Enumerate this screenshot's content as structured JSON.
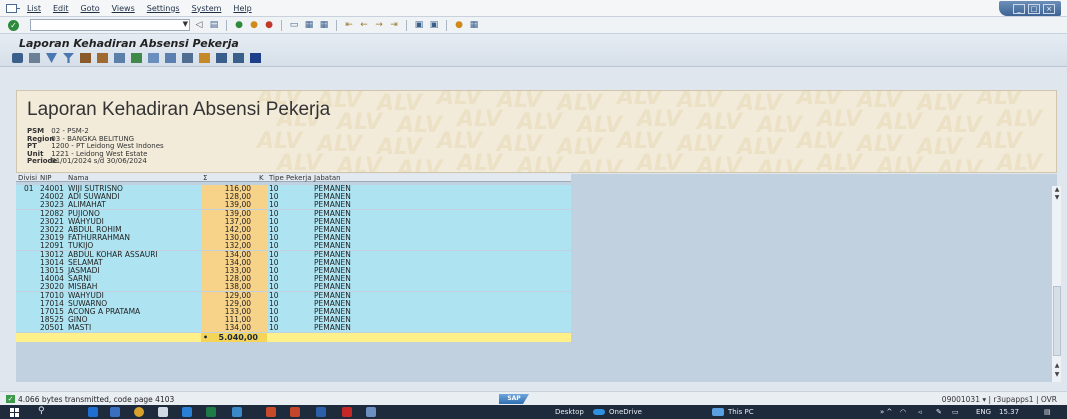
{
  "menu": {
    "items": [
      "List",
      "Edit",
      "Goto",
      "Views",
      "Settings",
      "System",
      "Help"
    ]
  },
  "title_bar": {
    "title": "Laporan Kehadiran Absensi Pekerja"
  },
  "header": {
    "report_title": "Laporan Kehadiran Absensi Pekerja",
    "fields": [
      {
        "key": "PSM",
        "value": "02 - PSM-2"
      },
      {
        "key": "Region",
        "value": "03 - BANGKA BELITUNG"
      },
      {
        "key": "PT",
        "value": "1200 - PT Leidong West Indones"
      },
      {
        "key": "Unit",
        "value": "1221 - Leidong West Estate"
      },
      {
        "key": "Periode",
        "value": "01/01/2024 s/d 30/06/2024"
      }
    ],
    "watermark": "ALV"
  },
  "grid": {
    "columns": [
      "Divisi",
      "NIP",
      "Nama",
      "Σ",
      "K",
      "Tipe Pekerja",
      "Jabatan"
    ],
    "divisi": "01",
    "rows": [
      {
        "nip": "24001",
        "nama": "WIJI SUTRISNO",
        "k": "116,00",
        "tipe": "10",
        "jabatan": "PEMANEN"
      },
      {
        "nip": "24002",
        "nama": "ADI SUWANDI",
        "k": "128,00",
        "tipe": "10",
        "jabatan": "PEMANEN"
      },
      {
        "nip": "23023",
        "nama": "ALIMAHAT",
        "k": "139,00",
        "tipe": "10",
        "jabatan": "PEMANEN"
      },
      {
        "nip": "12082",
        "nama": "PUJIONO",
        "k": "139,00",
        "tipe": "10",
        "jabatan": "PEMANEN"
      },
      {
        "nip": "23021",
        "nama": "WAHYUDI",
        "k": "137,00",
        "tipe": "10",
        "jabatan": "PEMANEN"
      },
      {
        "nip": "23022",
        "nama": "ABDUL ROHIM",
        "k": "142,00",
        "tipe": "10",
        "jabatan": "PEMANEN"
      },
      {
        "nip": "23019",
        "nama": "FATHURRAHMAN",
        "k": "130,00",
        "tipe": "10",
        "jabatan": "PEMANEN"
      },
      {
        "nip": "12091",
        "nama": "TUKIJO",
        "k": "132,00",
        "tipe": "10",
        "jabatan": "PEMANEN"
      },
      {
        "nip": "13012",
        "nama": "ABDUL KOHAR ASSAURI",
        "k": "134,00",
        "tipe": "10",
        "jabatan": "PEMANEN"
      },
      {
        "nip": "13014",
        "nama": "SELAMAT",
        "k": "134,00",
        "tipe": "10",
        "jabatan": "PEMANEN"
      },
      {
        "nip": "13015",
        "nama": "JASMADI",
        "k": "133,00",
        "tipe": "10",
        "jabatan": "PEMANEN"
      },
      {
        "nip": "14004",
        "nama": "SARNI",
        "k": "128,00",
        "tipe": "10",
        "jabatan": "PEMANEN"
      },
      {
        "nip": "23020",
        "nama": "MISBAH",
        "k": "138,00",
        "tipe": "10",
        "jabatan": "PEMANEN"
      },
      {
        "nip": "17010",
        "nama": "WAHYUDI",
        "k": "129,00",
        "tipe": "10",
        "jabatan": "PEMANEN"
      },
      {
        "nip": "17014",
        "nama": "SUWARNO",
        "k": "129,00",
        "tipe": "10",
        "jabatan": "PEMANEN"
      },
      {
        "nip": "17015",
        "nama": "ACONG A PRATAMA",
        "k": "133,00",
        "tipe": "10",
        "jabatan": "PEMANEN"
      },
      {
        "nip": "18525",
        "nama": "GINO",
        "k": "111,00",
        "tipe": "10",
        "jabatan": "PEMANEN"
      },
      {
        "nip": "20501",
        "nama": "MASTI",
        "k": "134,00",
        "tipe": "10",
        "jabatan": "PEMANEN"
      }
    ],
    "total": "5.040,00"
  },
  "status": {
    "message": "4.066 bytes transmitted, code page 4103",
    "logo": "SAP",
    "system_info": "09001031 ▾  |  r3upapps1  |  OVR"
  },
  "taskbar": {
    "desktop_label": "Desktop",
    "onedrive_label": "OneDrive",
    "thispc_label": "This PC",
    "lang": "ENG",
    "time": "15.37"
  },
  "colors": {
    "key_column": "#aee4f2",
    "sum_column": "#f7d289",
    "total_row": "#fff08a",
    "header_bg": "#f2ebda"
  }
}
